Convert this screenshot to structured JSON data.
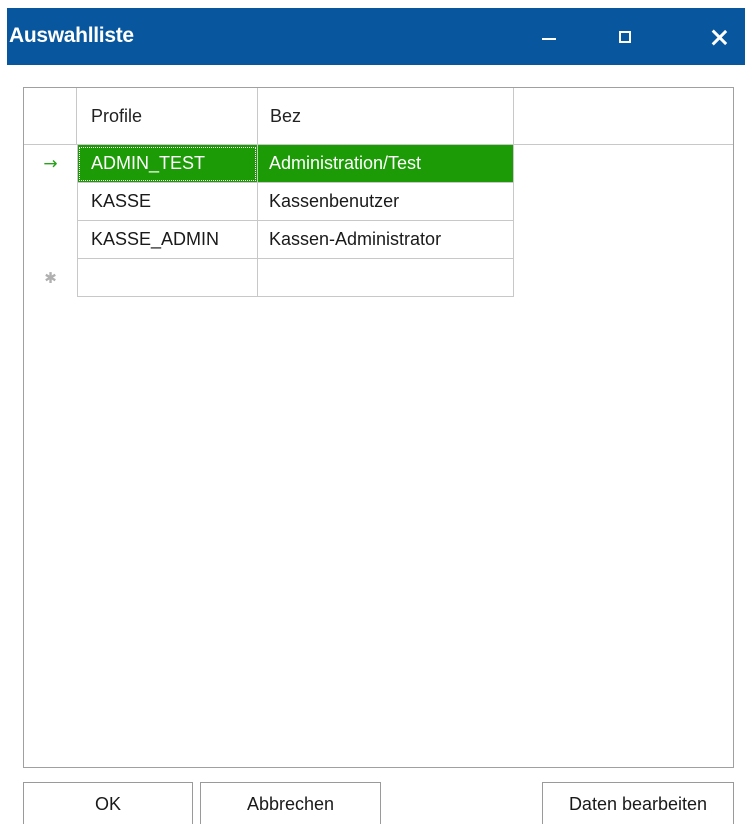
{
  "window": {
    "title": "Auswahlliste",
    "controls": {
      "minimize": "–",
      "maximize": "☐",
      "close": "✕"
    },
    "titlebar_color": "#07569e"
  },
  "grid": {
    "columns": [
      "Profile",
      "Bez",
      ""
    ],
    "rows": [
      {
        "indicator": "→",
        "profile": "ADMIN_TEST",
        "bez": "Administration/Test",
        "selected": true
      },
      {
        "indicator": "",
        "profile": "KASSE",
        "bez": "Kassenbenutzer",
        "selected": false
      },
      {
        "indicator": "",
        "profile": "KASSE_ADMIN",
        "bez": "Kassen-Administrator",
        "selected": false
      },
      {
        "indicator": "✱",
        "profile": "",
        "bez": "",
        "selected": false
      }
    ],
    "selection_color": "#1c9b06",
    "current_row_arrow_color": "#27a31a"
  },
  "buttons": {
    "ok": "OK",
    "cancel": "Abbrechen",
    "edit": "Daten bearbeiten"
  }
}
